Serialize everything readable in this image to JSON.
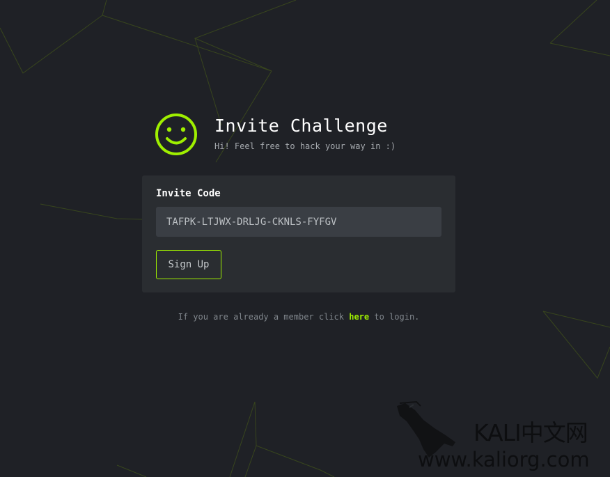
{
  "header": {
    "title": "Invite Challenge",
    "subtitle": "Hi! Feel free to hack your way in :)"
  },
  "form": {
    "label": "Invite Code",
    "invite_code_value": "TAFPK-LTJWX-DRLJG-CKNLS-FYFGV",
    "signup_label": "Sign Up"
  },
  "footer": {
    "prefix": "If you are already a member click ",
    "link_label": "here",
    "suffix": " to login."
  },
  "watermark": {
    "name": "KALI中文网",
    "url": "www.kaliorg.com"
  },
  "colors": {
    "accent": "#9fef00",
    "background": "#1f2126",
    "card": "#2a2d31",
    "input": "#3a3e44"
  },
  "icons": {
    "logo": "smiley-icon",
    "watermark": "kali-dragon-icon"
  }
}
